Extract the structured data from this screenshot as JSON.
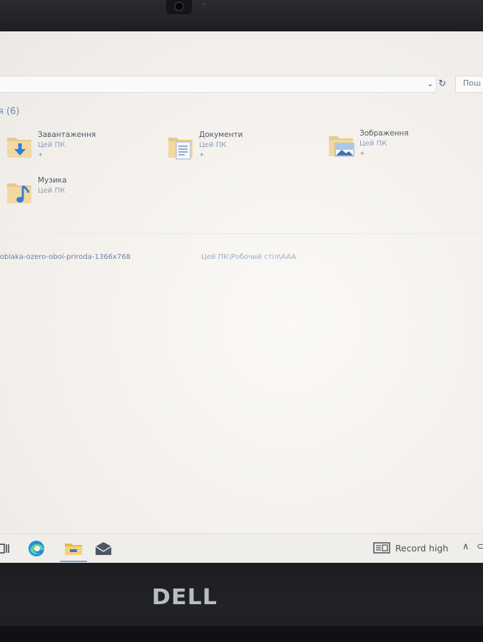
{
  "device": {
    "brand_logo": "DELL"
  },
  "explorer": {
    "search_placeholder": "Пош",
    "quick_access": {
      "header": "я (6)",
      "items": [
        {
          "name": "Завантаження",
          "location": "Цей ПК",
          "icon": "downloads-folder-icon",
          "pinned": true
        },
        {
          "name": "Документи",
          "location": "Цей ПК",
          "icon": "documents-folder-icon",
          "pinned": true
        },
        {
          "name": "Зображення",
          "location": "Цей ПК",
          "icon": "pictures-folder-icon",
          "pinned": true
        },
        {
          "name": "Музика",
          "location": "Цей ПК",
          "icon": "music-folder-icon",
          "pinned": false
        }
      ]
    },
    "recent": [
      {
        "name": "-oblaka-ozero-oboi-priroda-1366x768",
        "path": "Цей ПК\\Робочий стіл\\AAA"
      }
    ]
  },
  "taskbar": {
    "icons": [
      "task-view-icon",
      "edge-icon",
      "file-explorer-icon",
      "mail-icon"
    ],
    "news_text": "Record high",
    "accent": "#7aa0d6"
  }
}
